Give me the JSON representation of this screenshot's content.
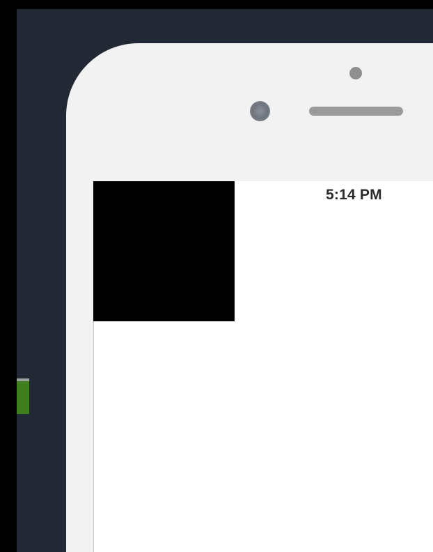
{
  "status_bar": {
    "time": "5:14 PM"
  },
  "icons": {
    "front_camera": "camera-icon",
    "earpiece": "speaker-icon",
    "proximity_sensor": "sensor-icon"
  },
  "colors": {
    "backdrop": "#222834",
    "bezel": "#f2f2f2",
    "screen": "#ffffff",
    "side_indicator": "#3f7f1f",
    "content_block": "#000000"
  }
}
